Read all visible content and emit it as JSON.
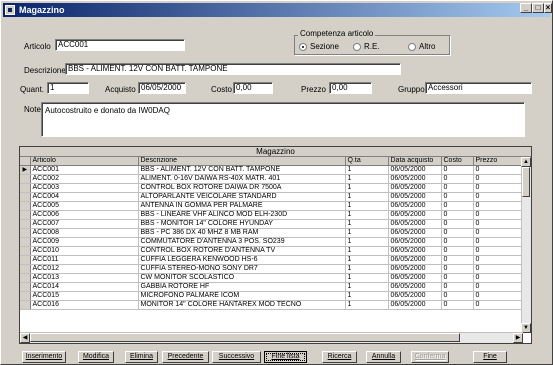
{
  "window": {
    "title": "Magazzino"
  },
  "form": {
    "articolo_label": "Articolo",
    "articolo_value": "ACC001",
    "competenza_label": "Competenza articolo",
    "competenza_options": [
      "Sezione",
      "R.E.",
      "Altro"
    ],
    "competenza_selected": "Sezione",
    "descrizione_label": "Descrizione",
    "descrizione_value": "BBS - ALIMENT. 12V CON BATT. TAMPONE",
    "quant_label": "Quant.",
    "quant_value": "1",
    "acquisto_label": "Acquisto",
    "acquisto_value": "06/05/2000",
    "costo_label": "Costo",
    "costo_value": "0,00",
    "prezzo_label": "Prezzo",
    "prezzo_value": "0,00",
    "gruppo_label": "Gruppo",
    "gruppo_value": "Accessori",
    "note_label": "Note",
    "note_value": "Autocostruito e donato da IW0DAQ"
  },
  "grid": {
    "title": "Magazzino",
    "columns": [
      "Articolo",
      "Descrizione",
      "Q.ta",
      "Data acquisto",
      "Costo",
      "Prezzo"
    ],
    "rows": [
      [
        "ACC001",
        "BBS - ALIMENT. 12V CON BATT. TAMPONE",
        "1",
        "06/05/2000",
        "0",
        "0"
      ],
      [
        "ACC002",
        "ALIMENT. 0-16V DAIWA RS-40X MATR. 401",
        "1",
        "06/05/2000",
        "0",
        "0"
      ],
      [
        "ACC003",
        "CONTROL BOX ROTORE DAIWA DR 7500A",
        "1",
        "06/05/2000",
        "0",
        "0"
      ],
      [
        "ACC004",
        "ALTOPARLANTE VEICOLARE STANDARD",
        "1",
        "06/05/2000",
        "0",
        "0"
      ],
      [
        "ACC005",
        "ANTENNA IN GOMMA PER PALMARE",
        "1",
        "06/05/2000",
        "0",
        "0"
      ],
      [
        "ACC006",
        "BBS - LINEARE VHF ALINCO MOD ELH-230D",
        "1",
        "06/05/2000",
        "0",
        "0"
      ],
      [
        "ACC007",
        "BBS - MONITOR 14\" COLORE HYUNDAY",
        "1",
        "06/05/2000",
        "0",
        "0"
      ],
      [
        "ACC008",
        "BBS - PC 386 DX 40 MHZ 8 MB RAM",
        "1",
        "06/05/2000",
        "0",
        "0"
      ],
      [
        "ACC009",
        "COMMUTATORE D'ANTENNA 3 POS. SO239",
        "1",
        "06/05/2000",
        "0",
        "0"
      ],
      [
        "ACC010",
        "CONTROL BOX ROTORE D'ANTENNA TV",
        "1",
        "06/05/2000",
        "0",
        "0"
      ],
      [
        "ACC011",
        "CUFFIA LEGGERA KENWOOD HS-6",
        "1",
        "06/05/2000",
        "0",
        "0"
      ],
      [
        "ACC012",
        "CUFFIA STEREO-MONO SONY DR7",
        "1",
        "06/05/2000",
        "0",
        "0"
      ],
      [
        "ACC013",
        "CW MONITOR SCOLASTICO",
        "1",
        "06/05/2000",
        "0",
        "0"
      ],
      [
        "ACC014",
        "GABBIA ROTORE HF",
        "1",
        "06/05/2000",
        "0",
        "0"
      ],
      [
        "ACC015",
        "MICROFONO PALMARE ICOM",
        "1",
        "06/05/2000",
        "0",
        "0"
      ],
      [
        "ACC016",
        "MONITOR 14\" COLORE HANTAREX MOD TECNO",
        "1",
        "06/05/2000",
        "0",
        "0"
      ]
    ]
  },
  "buttons": {
    "inserimento": "Inserimento",
    "modifica": "Modifica",
    "elimina": "Elimina",
    "precedente": "Precedente",
    "successivo": "Successivo",
    "fine_lista": "Fine lista",
    "ricerca": "Ricerca",
    "annulla": "Annulla",
    "conferma": "Conferma",
    "fine": "Fine"
  },
  "colors": {
    "titlebar_start": "#0a246a",
    "titlebar_end": "#a6caf0",
    "face": "#d4d0c8"
  }
}
